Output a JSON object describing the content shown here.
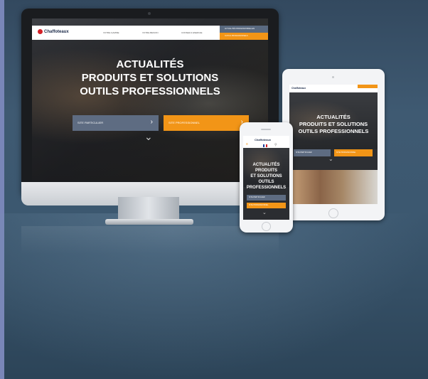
{
  "brand": {
    "name": "Chaffoteaux",
    "logo_color": "#d31f26"
  },
  "desktop": {
    "nav": {
      "links": [
        "VOTRE GAMME",
        "VOTRE BESOIN",
        "CONSEILS ENERGIE"
      ],
      "cta_top": "ACTUALITÉS PROFESSIONNELLES",
      "cta_bottom": "OUTILS PROFESSIONNELS"
    },
    "hero": {
      "line1": "ACTUALITÉS",
      "line2": "PRODUITS ET SOLUTIONS",
      "line3": "OUTILS PROFESSIONNELS"
    },
    "buttons": {
      "particulier": "SITE PARTICULIER",
      "professionnel": "SITE PROFESSIONNEL"
    }
  },
  "tablet": {
    "hero": {
      "line1": "ACTUALITÉS",
      "line2": "PRODUITS ET SOLUTIONS",
      "line3": "OUTILS PROFESSIONNELS"
    }
  },
  "phone": {
    "hero": {
      "line1": "ACTUALITÉS",
      "line2": "PRODUITS",
      "line3": "ET SOLUTIONS",
      "line4": "OUTILS",
      "line5": "PROFESSIONNELS"
    }
  },
  "colors": {
    "accent_orange": "#f29517",
    "button_slate": "#5e6c82",
    "background": "#3f5a72"
  },
  "icons": [
    "chevron-right-icon",
    "chevron-down-icon",
    "hamburger-icon",
    "flag-fr-icon",
    "search-icon",
    "home-button-icon"
  ]
}
